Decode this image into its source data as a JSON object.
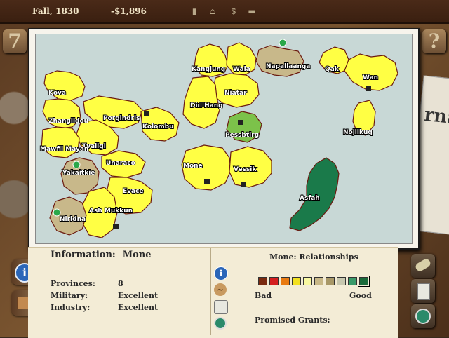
{
  "top_bar": {
    "date": "Fall, 1830",
    "treasury": "-$1,896",
    "icons": [
      "factory-icon",
      "capitol-icon",
      "dollar-icon",
      "trade-icon"
    ]
  },
  "corner_buttons": {
    "left": "7",
    "right": "?"
  },
  "newspaper_text": "rna",
  "map": {
    "water_color": "#c8d8d6",
    "player_color": "#ffff44",
    "selected_color": "#1a7a4a",
    "provinces": [
      {
        "name": "Kangjung",
        "color": "#ffff44"
      },
      {
        "name": "Wala",
        "color": "#ffff44"
      },
      {
        "name": "Napallaanga",
        "color": "#c8b88a"
      },
      {
        "name": "Qak",
        "color": "#ffff44"
      },
      {
        "name": "Wan",
        "color": "#ffff44"
      },
      {
        "name": "Niatar",
        "color": "#ffff44"
      },
      {
        "name": "Din Hang",
        "color": "#ffff44"
      },
      {
        "name": "Pessbtirg",
        "color": "#ffff44"
      },
      {
        "name": "Nojiikuq",
        "color": "#ffff44"
      },
      {
        "name": "Kova",
        "color": "#ffff44"
      },
      {
        "name": "Zhanglidou",
        "color": "#ffff44"
      },
      {
        "name": "Porgindris",
        "color": "#7cc24a"
      },
      {
        "name": "Kolombu",
        "color": "#ffff44"
      },
      {
        "name": "Tvaligi",
        "color": "#ffff44"
      },
      {
        "name": "Mawfil Mayan",
        "color": "#ffff44"
      },
      {
        "name": "Unaraco",
        "color": "#ffff44"
      },
      {
        "name": "Yakaitkie",
        "color": "#ffff44"
      },
      {
        "name": "Evace",
        "color": "#ffff44"
      },
      {
        "name": "Ash Mukkun",
        "color": "#c8b88a"
      },
      {
        "name": "Niridna",
        "color": "#ffff44"
      },
      {
        "name": "Mone",
        "color": "#1a7a4a"
      },
      {
        "name": "Vessik",
        "color": "#ffff44"
      },
      {
        "name": "Asfah",
        "color": "#c8b88a"
      }
    ]
  },
  "info": {
    "label": "Information:",
    "name": "Mone",
    "stats": [
      {
        "label": "Provinces:",
        "value": "8"
      },
      {
        "label": "Military:",
        "value": "Excellent"
      },
      {
        "label": "Industry:",
        "value": "Excellent"
      }
    ]
  },
  "relationships": {
    "title": "Mone: Relationships",
    "scale_colors": [
      "#7a2a10",
      "#d42020",
      "#e87a10",
      "#f2e020",
      "#f8f8a0",
      "#c8b888",
      "#a89868",
      "#c8c8b0",
      "#3a9a6a",
      "#1a6a3a"
    ],
    "selected_index": 9,
    "bad_label": "Bad",
    "good_label": "Good",
    "grants_label": "Promised Grants:"
  },
  "side_icons": [
    "info-icon",
    "scroll-icon",
    "document-icon",
    "capitol-icon"
  ],
  "right_tabs": [
    "scroll-icon",
    "notepad-icon",
    "capitol-icon"
  ]
}
